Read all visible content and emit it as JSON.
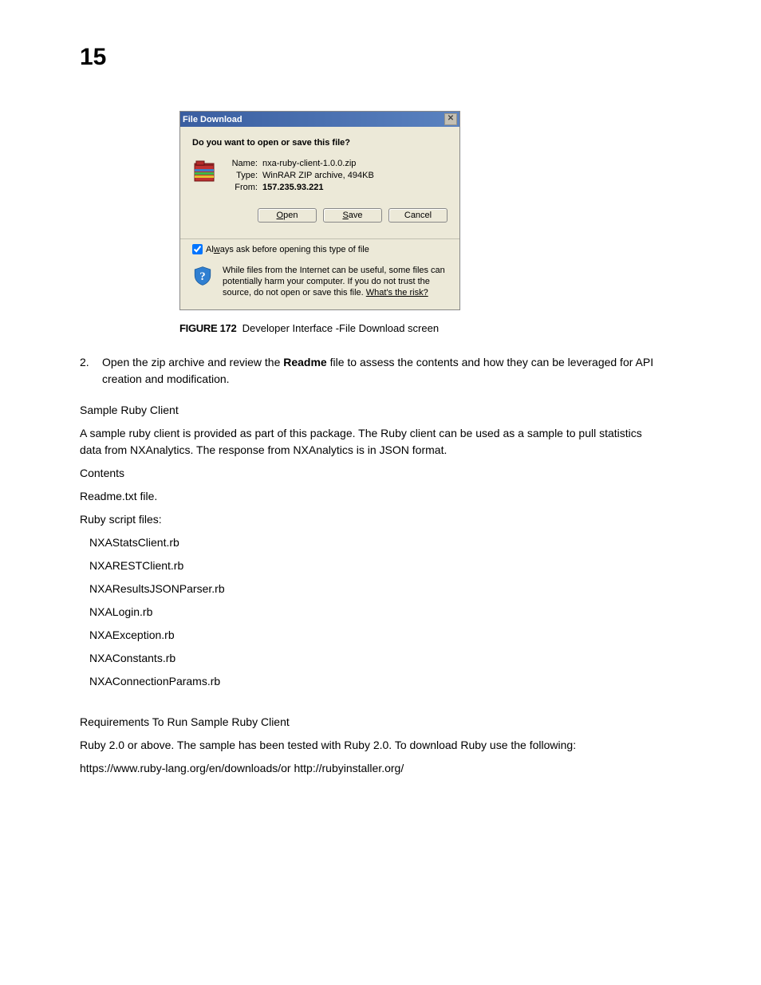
{
  "chapter": "15",
  "dialog": {
    "title": "File Download",
    "prompt": "Do you want to open or save this file?",
    "name_label": "Name:",
    "name_value": "nxa-ruby-client-1.0.0.zip",
    "type_label": "Type:",
    "type_value": "WinRAR ZIP archive, 494KB",
    "from_label": "From:",
    "from_value": "157.235.93.221",
    "btn_open": "Open",
    "btn_save": "Save",
    "btn_cancel": "Cancel",
    "checkbox_label_pre": "Al",
    "checkbox_label_ul": "w",
    "checkbox_label_post": "ays ask before opening this type of file",
    "warning": "While files from the Internet can be useful, some files can potentially harm your computer. If you do not trust the source, do not open or save this file. ",
    "warning_link": "What's the risk?"
  },
  "figure": {
    "label": "FIGURE 172",
    "caption": "Developer Interface -File Download screen"
  },
  "step": {
    "num": "2.",
    "text_a": "Open the zip archive and review the ",
    "bold": "Readme",
    "text_b": " file to assess the contents and how they can be leveraged for API creation and modification."
  },
  "body": {
    "h_sample": "Sample Ruby Client",
    "p_sample": "A sample ruby client is provided as part of this package. The Ruby client can be used as a sample to pull statistics data from NXAnalytics. The response from NXAnalytics is in JSON format.",
    "h_contents": "Contents",
    "readme": "Readme.txt file.",
    "ruby_files_h": "Ruby script files:",
    "files": [
      "NXAStatsClient.rb",
      "NXARESTClient.rb",
      "NXAResultsJSONParser.rb",
      "NXALogin.rb",
      "NXAException.rb",
      "NXAConstants.rb",
      "NXAConnectionParams.rb"
    ],
    "h_req": "Requirements To Run Sample Ruby Client",
    "p_req1": "Ruby 2.0 or above. The sample has been tested with Ruby 2.0. To download Ruby use the following:",
    "p_req2": "https://www.ruby-lang.org/en/downloads/or http://rubyinstaller.org/"
  }
}
